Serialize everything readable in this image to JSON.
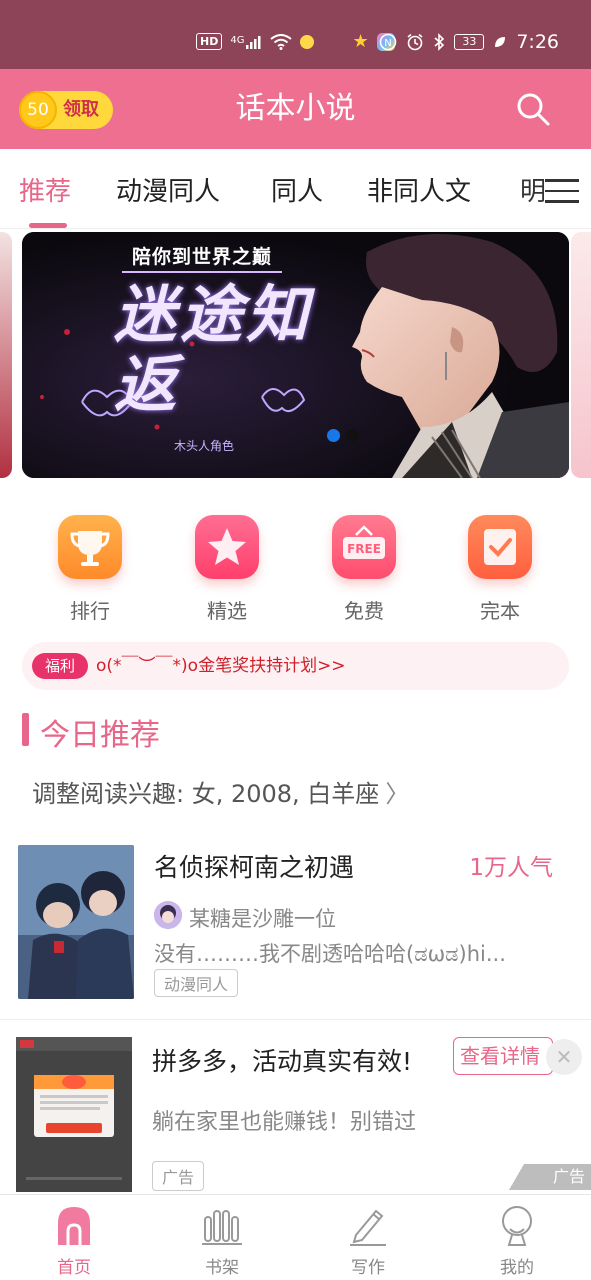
{
  "status_bar": {
    "time": "7:26",
    "network": "HD",
    "signal": "4G",
    "battery": "33"
  },
  "header": {
    "coin_count": "50",
    "coin_label": "领取",
    "title": "话本小说"
  },
  "tabs": [
    {
      "label": "推荐",
      "active": true
    },
    {
      "label": "动漫同人",
      "active": false
    },
    {
      "label": "同人",
      "active": false
    },
    {
      "label": "非同人文",
      "active": false
    },
    {
      "label": "明",
      "active": false
    }
  ],
  "banner": {
    "subtitle": "陪你到世界之巅",
    "title": "迷途知返",
    "author": "木头人角色"
  },
  "categories": [
    {
      "label": "排行",
      "icon": "trophy-icon",
      "color": "#ff9a3c"
    },
    {
      "label": "精选",
      "icon": "star-icon",
      "color": "#ff4f7b"
    },
    {
      "label": "免费",
      "icon": "free-sign-icon",
      "color": "#ff5f7a"
    },
    {
      "label": "完本",
      "icon": "check-book-icon",
      "color": "#ff7a4f"
    }
  ],
  "notice": {
    "badge": "福利",
    "text": "o(*￣︶￣*)o金笔奖扶持计划>>"
  },
  "section": {
    "title": "今日推荐",
    "preference": "调整阅读兴趣: 女, 2008, 白羊座"
  },
  "book": {
    "title": "名侦探柯南之初遇",
    "popularity": "1万人气",
    "author": "某糖是沙雕一位",
    "description": "没有………我不剧透哈哈哈(ಡωಡ)hi...",
    "tag": "动漫同人"
  },
  "ad": {
    "title": "拼多多，活动真实有效!",
    "cta": "查看详情",
    "description": "躺在家里也能赚钱！别错过",
    "tag": "广告",
    "mark": "广告"
  },
  "bottom_nav": [
    {
      "label": "首页",
      "active": true
    },
    {
      "label": "书架",
      "active": false
    },
    {
      "label": "写作",
      "active": false
    },
    {
      "label": "我的",
      "active": false
    }
  ],
  "colors": {
    "accent": "#e8668a",
    "header": "#ef6f91",
    "status_bar": "#8d4358"
  }
}
